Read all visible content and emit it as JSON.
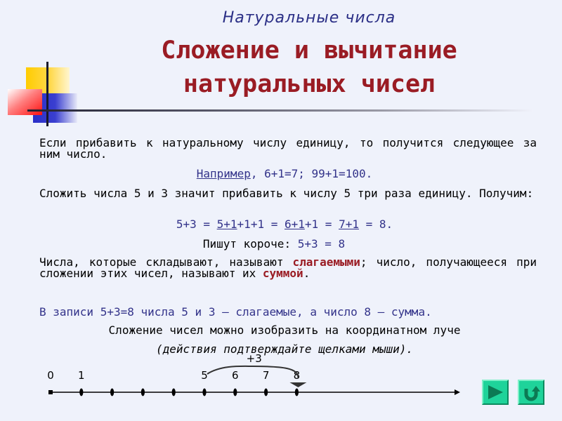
{
  "header": {
    "subtitle": "Натуральные числа",
    "title_line1": "Сложение и вычитание",
    "title_line2": "натуральных чисел"
  },
  "content": {
    "p1": "Если прибавить к натуральному числу единицу, то получится следующее за ним число.",
    "p2": {
      "example_link": "Например",
      "example_rest": ", 6+1=7; 99+1=100."
    },
    "p3": "Сложить числа 5 и 3 значит прибавить к числу 5 три раза единицу. Получим:",
    "p4": {
      "part1": "5+3 = ",
      "u1": "5+1",
      "part2": "+1+1 = ",
      "u2": "6+1",
      "part3": "+1 = ",
      "u3": "7+1",
      "part4": " = 8."
    },
    "p5": {
      "label": "Пишут короче: ",
      "formula": "5+3 = 8"
    },
    "p6": {
      "part1": "Числа, которые складывают, называют ",
      "term1": "слагаемыми",
      "part2": "; число, получающееся при сложении этих чисел, называют их ",
      "term2": "суммой",
      "part3": "."
    },
    "p7": "В записи 5+3=8 числа 5 и 3 – слагаемые, а число 8 – сумма.",
    "p8": "Сложение чисел можно изобразить на координатном луче",
    "p9": "(действия подтверждайте щелками мыши)."
  },
  "number_line": {
    "visible_labels": [
      {
        "value": 0,
        "text": "0"
      },
      {
        "value": 1,
        "text": "1"
      },
      {
        "value": 5,
        "text": "5"
      },
      {
        "value": 6,
        "text": "6"
      },
      {
        "value": 7,
        "text": "7"
      },
      {
        "value": 8,
        "text": "8"
      }
    ],
    "points": [
      0,
      1,
      2,
      3,
      4,
      5,
      6,
      7,
      8
    ],
    "jump": {
      "from": 5,
      "to": 8,
      "label": "+3"
    }
  },
  "nav": {
    "next_button": "next-slide",
    "return_button": "return"
  },
  "colors": {
    "background": "#eff2fb",
    "title": "#9a1c24",
    "subtitle": "#2b2f86",
    "highlight_blue": "#33338a",
    "button": "#1fd39a",
    "button_icon": "#0c7a54"
  }
}
